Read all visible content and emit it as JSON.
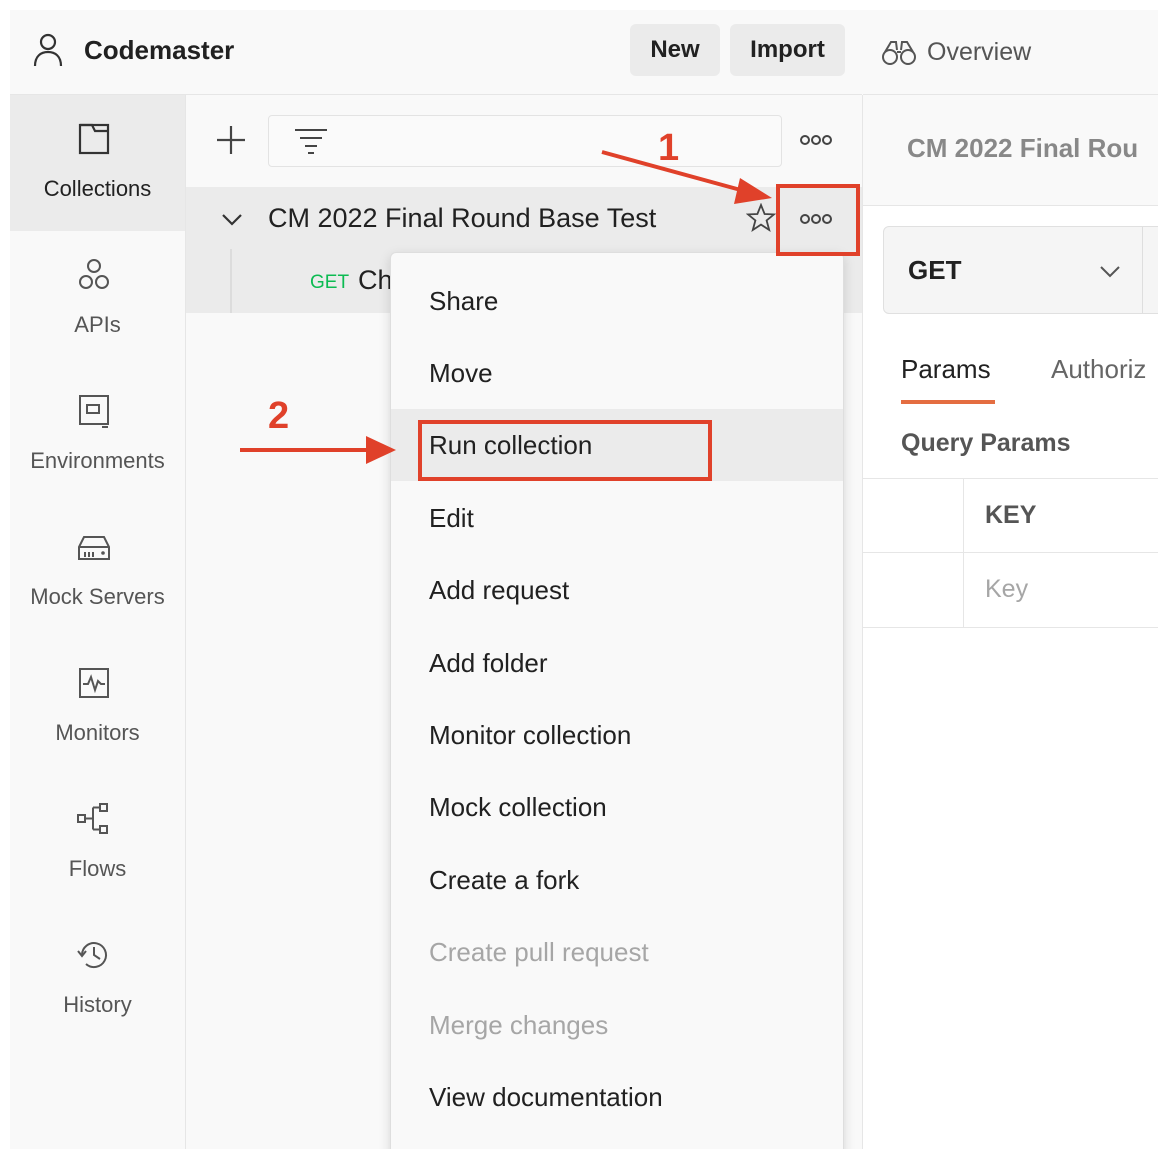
{
  "header": {
    "workspace_name": "Codemaster",
    "new_label": "New",
    "import_label": "Import"
  },
  "nav": {
    "items": [
      {
        "label": "Collections",
        "icon": "collections-icon",
        "active": true
      },
      {
        "label": "APIs",
        "icon": "apis-icon"
      },
      {
        "label": "Environments",
        "icon": "environments-icon"
      },
      {
        "label": "Mock Servers",
        "icon": "mock-servers-icon"
      },
      {
        "label": "Monitors",
        "icon": "monitors-icon"
      },
      {
        "label": "Flows",
        "icon": "flows-icon"
      },
      {
        "label": "History",
        "icon": "history-icon"
      }
    ]
  },
  "sidebar": {
    "collection_name": "CM 2022 Final Round Base Test",
    "request": {
      "method": "GET",
      "name": "Ch"
    }
  },
  "annotations": {
    "step1": "1",
    "step2": "2",
    "color": "#e0412a"
  },
  "context_menu": {
    "items": [
      {
        "label": "Share"
      },
      {
        "label": "Move"
      },
      {
        "label": "Run collection",
        "highlighted": true
      },
      {
        "label": "Edit"
      },
      {
        "label": "Add request"
      },
      {
        "label": "Add folder"
      },
      {
        "label": "Monitor collection"
      },
      {
        "label": "Mock collection"
      },
      {
        "label": "Create a fork"
      },
      {
        "label": "Create pull request",
        "disabled": true
      },
      {
        "label": "Merge changes",
        "disabled": true
      },
      {
        "label": "View documentation"
      }
    ]
  },
  "right_pane": {
    "overview_tab": "Overview",
    "request_title": "CM 2022 Final Rou",
    "method": "GET",
    "tabs": [
      "Params",
      "Authoriz"
    ],
    "query_params_label": "Query Params",
    "key_header": "KEY",
    "key_placeholder": "Key"
  },
  "colors": {
    "accent": "#e46d41",
    "get_method": "#0cbb52",
    "annotation": "#e0412a"
  }
}
